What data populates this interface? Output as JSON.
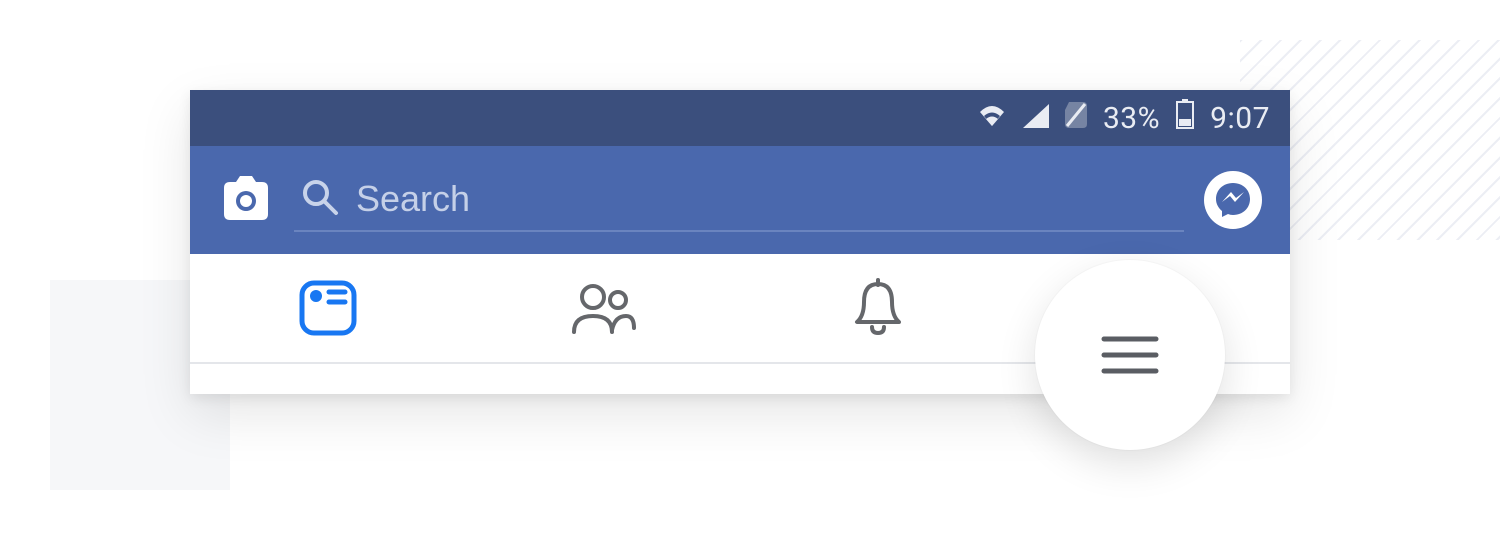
{
  "statusbar": {
    "battery_percent": "33%",
    "clock": "9:07"
  },
  "toolbar": {
    "search_placeholder": "Search"
  },
  "tabs": [
    {
      "id": "feed",
      "icon": "newsfeed-icon",
      "active": true
    },
    {
      "id": "friends",
      "icon": "friends-icon",
      "active": false
    },
    {
      "id": "notifications",
      "icon": "bell-icon",
      "active": false
    },
    {
      "id": "menu",
      "icon": "hamburger-icon",
      "active": false
    }
  ],
  "colors": {
    "statusbar_bg": "#3b4f7d",
    "appbar_bg": "#4a68ad",
    "active": "#1877f2",
    "inactive": "#65676b"
  }
}
